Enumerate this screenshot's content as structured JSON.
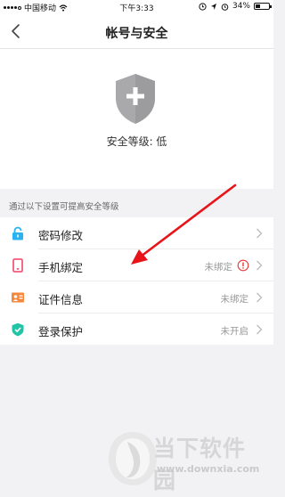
{
  "status_bar": {
    "carrier": "中国移动",
    "time": "下午3:33",
    "battery": "34%",
    "battery_fraction": 0.34
  },
  "nav": {
    "title": "帐号与安全",
    "back_icon": "chevron-left-icon"
  },
  "security": {
    "shield_icon": "shield-plus-icon",
    "level_text": "安全等级: 低"
  },
  "section_hint": "通过以下设置可提高安全等级",
  "menu": {
    "items": [
      {
        "label": "密码修改",
        "status": "",
        "icon": "lock-icon",
        "icon_color": "#2ab3f0"
      },
      {
        "label": "手机绑定",
        "status": "未绑定",
        "icon": "phone-icon",
        "icon_color": "#f25b7a",
        "warning": true
      },
      {
        "label": "证件信息",
        "status": "未绑定",
        "icon": "id-card-icon",
        "icon_color": "#f5883b"
      },
      {
        "label": "登录保护",
        "status": "未开启",
        "icon": "shield-check-icon",
        "icon_color": "#22c4a8"
      }
    ]
  },
  "colors": {
    "warning": "#e53935",
    "arrow": "#e8141a",
    "shield": "#a9a9ab"
  },
  "watermark": {
    "name": "当下软件园",
    "url": "www.downxia.com"
  }
}
